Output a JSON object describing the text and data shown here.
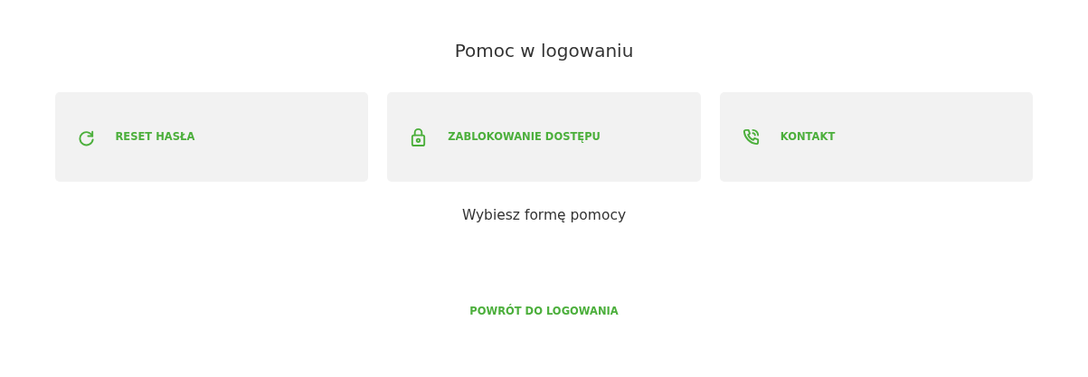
{
  "title": "Pomoc w logowaniu",
  "options": [
    {
      "kind": "reset",
      "label": "RESET HASŁA"
    },
    {
      "kind": "lock",
      "label": "ZABLOKOWANIE DOSTĘPU"
    },
    {
      "kind": "phone",
      "label": "KONTAKT"
    }
  ],
  "subtitle": "Wybiesz formę pomocy",
  "back_link": "POWRÓT DO LOGOWANIA"
}
